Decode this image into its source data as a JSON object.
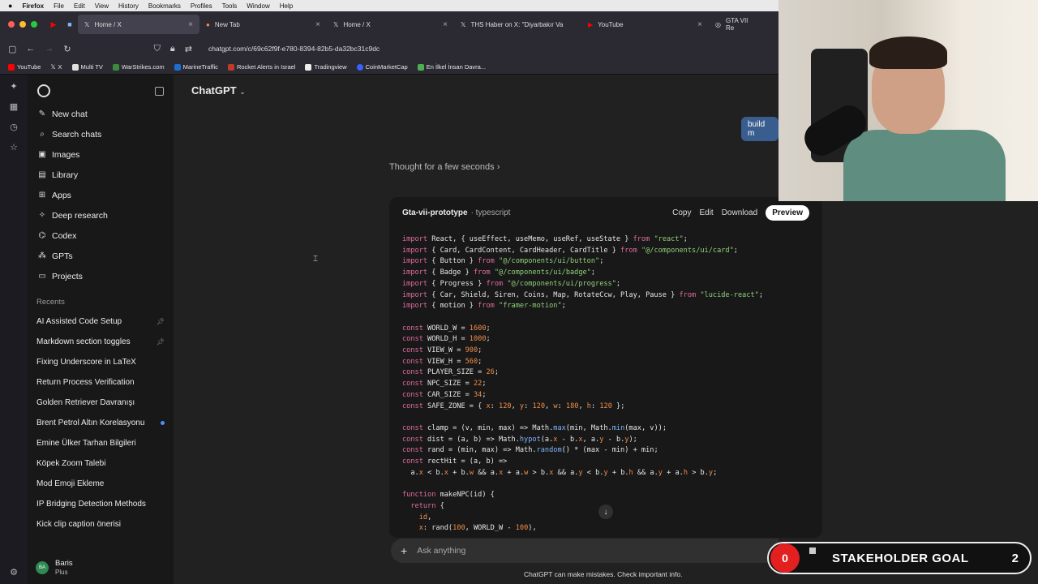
{
  "menubar": {
    "apple": "",
    "app": "Firefox",
    "items": [
      "File",
      "Edit",
      "View",
      "History",
      "Bookmarks",
      "Profiles",
      "Tools",
      "Window",
      "Help"
    ]
  },
  "tabs": [
    {
      "label": "Home / X",
      "active": true
    },
    {
      "label": "New Tab",
      "active": false
    },
    {
      "label": "Home / X",
      "active": false
    },
    {
      "label": "THS Haber on X: \"Diyarbakır Va",
      "active": false
    },
    {
      "label": "YouTube",
      "active": false
    },
    {
      "label": "GTA VII Re",
      "active": false
    }
  ],
  "url": "chatgpt.com/c/69c62f9f-e780-8394-82b5-da32bc31c9dc",
  "bookmarks": [
    {
      "label": "YouTube",
      "color": "#ff0000"
    },
    {
      "label": "X",
      "color": "#ffffff"
    },
    {
      "label": "Multi TV",
      "color": "#e0e0e0"
    },
    {
      "label": "WarStrikes.com",
      "color": "#3c8a3c"
    },
    {
      "label": "MarineTraffic",
      "color": "#1c6fd1"
    },
    {
      "label": "Rocket Alerts in Israel",
      "color": "#c0392b"
    },
    {
      "label": "Tradingview",
      "color": "#eeeeee"
    },
    {
      "label": "CoinMarketCap",
      "color": "#3861fb"
    },
    {
      "label": "En İlkel İnsan Davra...",
      "color": "#4caf50"
    }
  ],
  "sidebar": {
    "nav": [
      {
        "label": "New chat",
        "icon": "✎"
      },
      {
        "label": "Search chats",
        "icon": "⌕"
      },
      {
        "label": "Images",
        "icon": "▣"
      },
      {
        "label": "Library",
        "icon": "▤"
      },
      {
        "label": "Apps",
        "icon": "⊞"
      },
      {
        "label": "Deep research",
        "icon": "✧"
      },
      {
        "label": "Codex",
        "icon": "⌬"
      },
      {
        "label": "GPTs",
        "icon": "⁂"
      },
      {
        "label": "Projects",
        "icon": "▭"
      }
    ],
    "recents_title": "Recents",
    "recents": [
      {
        "label": "AI Assisted Code Setup",
        "marker": "pin"
      },
      {
        "label": "Markdown section toggles",
        "marker": "pin"
      },
      {
        "label": "Fixing Underscore in LaTeX",
        "marker": ""
      },
      {
        "label": "Return Process Verification",
        "marker": ""
      },
      {
        "label": "Golden Retriever Davranışı",
        "marker": ""
      },
      {
        "label": "Brent Petrol Altın Korelasyonu",
        "marker": "dot"
      },
      {
        "label": "Emine Ülker Tarhan Bilgileri",
        "marker": ""
      },
      {
        "label": "Köpek Zoom Talebi",
        "marker": ""
      },
      {
        "label": "Mod Emoji Ekleme",
        "marker": ""
      },
      {
        "label": "IP Bridging Detection Methods",
        "marker": ""
      },
      {
        "label": "Kick clip caption önerisi",
        "marker": ""
      }
    ],
    "user": {
      "initials": "BA",
      "name": "Baris",
      "plan": "Plus"
    }
  },
  "main": {
    "model": "ChatGPT",
    "user_message": "build m",
    "thought": "Thought for a few seconds ›",
    "code_card": {
      "title": "Gta-vii-prototype",
      "lang": "· typescript",
      "actions": [
        "Copy",
        "Edit",
        "Download"
      ],
      "preview": "Preview"
    },
    "composer_placeholder": "Ask anything",
    "disclaimer": "ChatGPT can make mistakes. Check important info."
  },
  "overlay": {
    "goal_label": "STAKEHOLDER GOAL",
    "goal_count": "2",
    "live_count": "0"
  }
}
